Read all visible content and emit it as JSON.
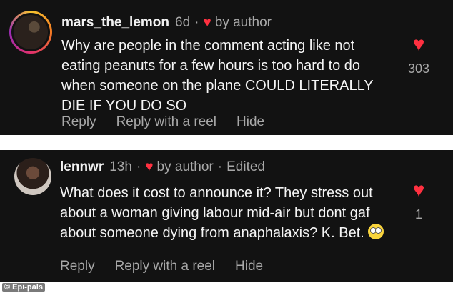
{
  "comments": [
    {
      "username": "mars_the_lemon",
      "time": "6d",
      "author_label": "by author",
      "edited": "",
      "text": "Why are people in the comment acting like not eating peanuts for a few hours is too hard to do when someone on the plane COULD LITERALLY DIE IF YOU DO SO",
      "likes": "303",
      "actions": [
        "Reply",
        "Reply with a reel",
        "Hide"
      ]
    },
    {
      "username": "lennwr",
      "time": "13h",
      "author_label": "by author",
      "edited": "Edited",
      "text": "What does it cost to announce it? They stress out about a woman giving labour mid-air but dont gaf about someone dying from anaphalaxis? K. Bet.",
      "likes": "1",
      "actions": [
        "Reply",
        "Reply with a reel",
        "Hide"
      ]
    }
  ],
  "watermark": "© Epi-pals",
  "icons": {
    "heart": "heart-icon",
    "emoji": "rolling-eyes-emoji-icon"
  },
  "colors": {
    "panel_bg": "#121212",
    "heart": "#ff3040",
    "muted_text": "#a8a8a8"
  }
}
